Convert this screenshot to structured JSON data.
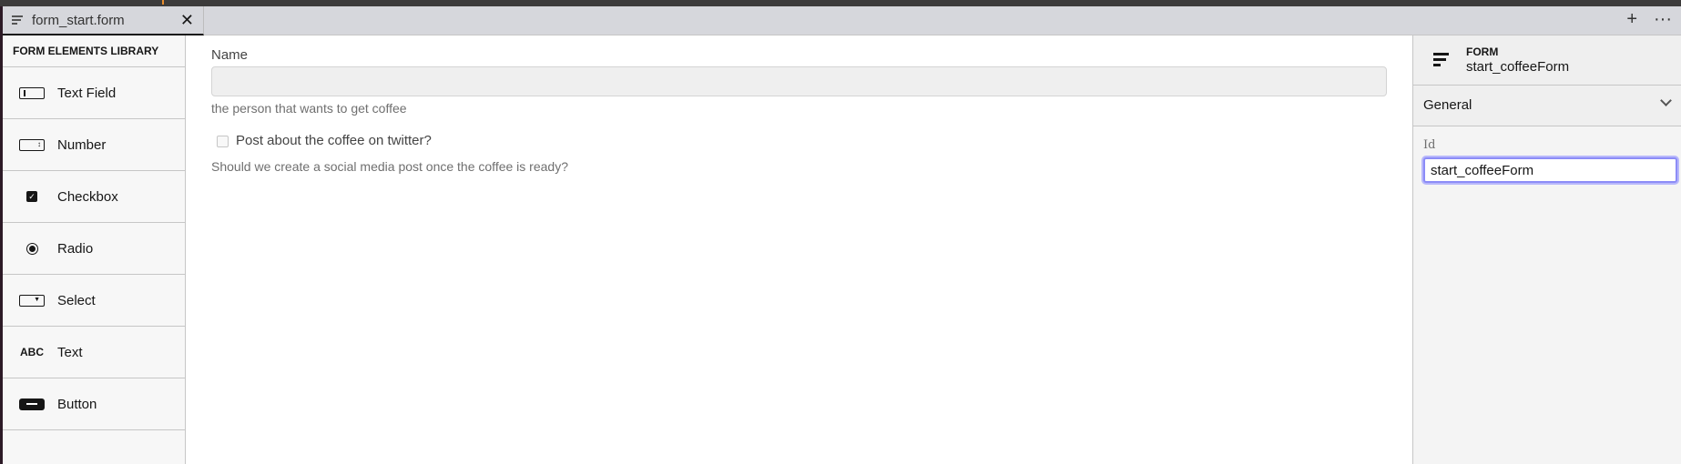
{
  "tab": {
    "title": "form_start.form",
    "close": "✕",
    "icon": "form-icon"
  },
  "tab_actions": {
    "add": "+",
    "more": "···"
  },
  "library": {
    "title": "FORM ELEMENTS LIBRARY",
    "items": [
      {
        "label": "Text Field",
        "icon": "textfield-icon"
      },
      {
        "label": "Number",
        "icon": "number-icon"
      },
      {
        "label": "Checkbox",
        "icon": "checkbox-icon"
      },
      {
        "label": "Radio",
        "icon": "radio-icon"
      },
      {
        "label": "Select",
        "icon": "select-icon"
      },
      {
        "label": "Text",
        "icon": "text-icon",
        "glyph": "ABC"
      },
      {
        "label": "Button",
        "icon": "button-icon"
      }
    ]
  },
  "canvas": {
    "name_field": {
      "label": "Name",
      "value": "",
      "description": "the person that wants to get coffee"
    },
    "twitter_checkbox": {
      "label": "Post about the coffee on twitter?",
      "checked": false,
      "description": "Should we create a social media post once the coffee is ready?"
    }
  },
  "properties": {
    "type": "FORM",
    "name": "start_coffeeForm",
    "group": "General",
    "id_label": "Id",
    "id_value": "start_coffeeForm"
  }
}
